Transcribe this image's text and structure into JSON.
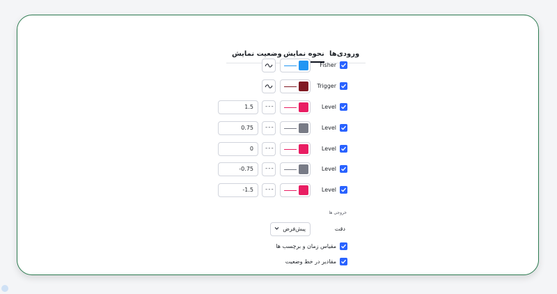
{
  "tabs": [
    {
      "label": "ورودی‌ها",
      "active": false
    },
    {
      "label": "نحوه نمایش",
      "active": true
    },
    {
      "label": "وضعیت نمایش",
      "active": false
    }
  ],
  "rows": [
    {
      "label": "Fisher",
      "color": "#2196f3",
      "line_color": "#2196f3",
      "style": "line"
    },
    {
      "label": "Trigger",
      "color": "#801922",
      "line_color": "#801922",
      "style": "line"
    },
    {
      "label": "Level",
      "color": "#e91e63",
      "line_color": "#e91e63",
      "style": "dashed",
      "value": "1.5"
    },
    {
      "label": "Level",
      "color": "#787b86",
      "line_color": "#787b86",
      "style": "dashed",
      "value": "0.75"
    },
    {
      "label": "Level",
      "color": "#e91e63",
      "line_color": "#e91e63",
      "style": "dashed",
      "value": "0"
    },
    {
      "label": "Level",
      "color": "#787b86",
      "line_color": "#787b86",
      "style": "dashed",
      "value": "-0.75"
    },
    {
      "label": "Level",
      "color": "#e91e63",
      "line_color": "#e91e63",
      "style": "dashed",
      "value": "-1.5"
    }
  ],
  "outputs": {
    "title": "خروجی ها",
    "precision_label": "دقت",
    "precision_value": "پیش‌فرض",
    "scale_label": "مقیاس زمان و برچسب ها",
    "status_label": "مقادیر در خط وضعیت"
  },
  "colors": {
    "accent": "#2962ff",
    "card_border": "#2b7a4f"
  }
}
